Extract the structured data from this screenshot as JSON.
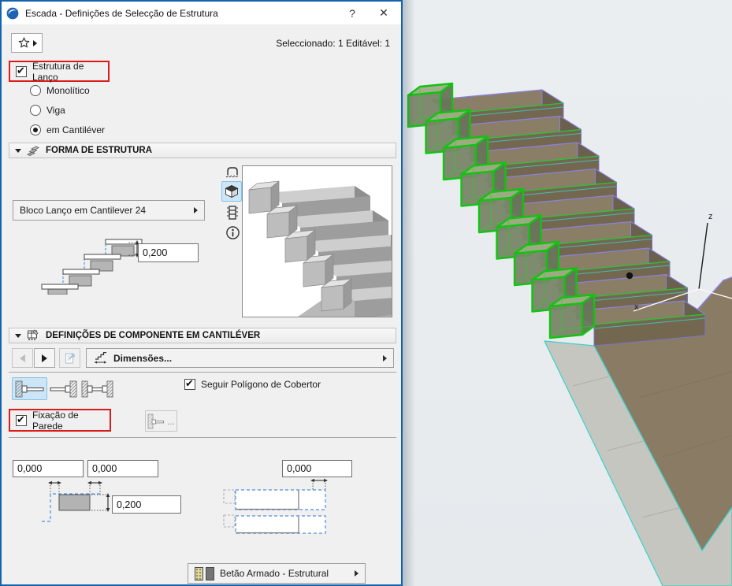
{
  "window": {
    "title": "Escada - Definições de Selecção de Estrutura",
    "help": "?",
    "close": "✕",
    "status": "Seleccionado: 1 Editável: 1"
  },
  "flight": {
    "label": "Estrutura de Lanço",
    "options": {
      "monolitico": "Monolítico",
      "viga": "Viga",
      "cantilever": "em Cantiléver"
    }
  },
  "form_section": {
    "title": "FORMA DE ESTRUTURA",
    "profile": "Bloco Lanço em Cantilever 24",
    "thickness": "0,200"
  },
  "component_section": {
    "title": "DEFINIÇÕES DE COMPONENTE EM CANTILÉVER",
    "dimensions": "Dimensões...",
    "follow_polygon": "Seguir Polígono de Cobertor",
    "wall_fixing": "Fixação de Parede",
    "more": "...",
    "offset_left": "0,000",
    "offset_mid": "0,000",
    "offset_right": "0,000",
    "block_height": "0,200"
  },
  "footer": {
    "material": "Betão Armado - Estrutural"
  },
  "viewport": {
    "axis_z": "z",
    "axis_x": "x"
  },
  "colors": {
    "highlight": "#dc1a1a",
    "selection_fill": "#cde6f7",
    "selection_green": "#12c312",
    "window_border": "#1463ae",
    "viewport_bg": "#e9edf0"
  }
}
